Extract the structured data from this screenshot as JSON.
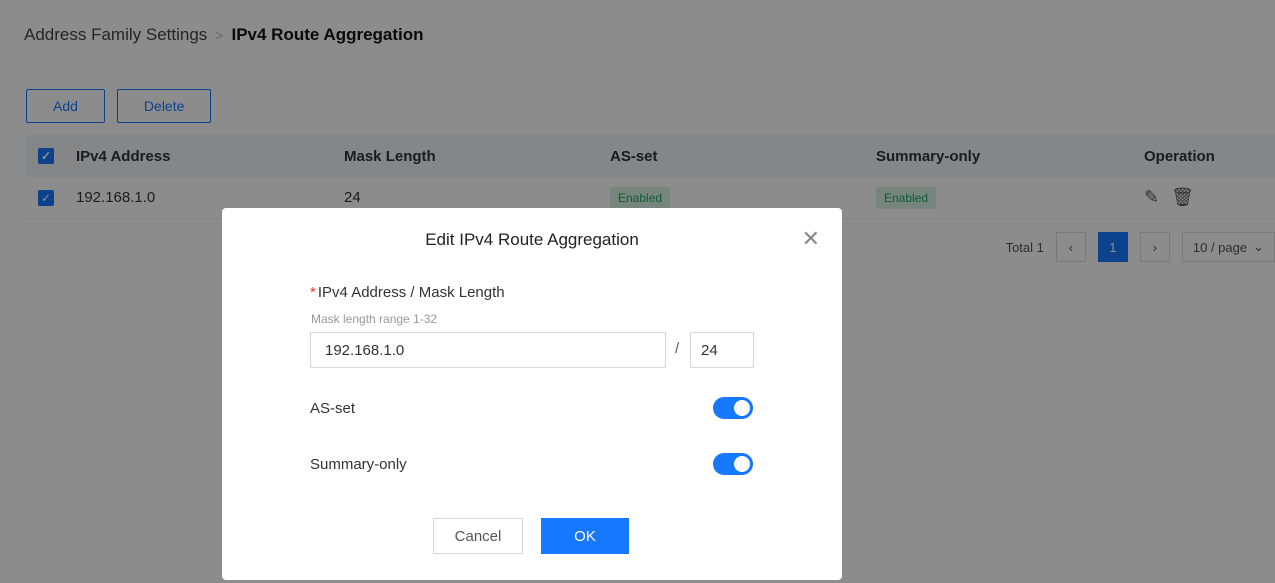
{
  "breadcrumb": {
    "parent": "Address Family Settings",
    "separator": ">",
    "current": "IPv4 Route Aggregation"
  },
  "toolbar": {
    "add_label": "Add",
    "delete_label": "Delete"
  },
  "table": {
    "headers": [
      "IPv4 Address",
      "Mask Length",
      "AS-set",
      "Summary-only",
      "Operation"
    ],
    "rows": [
      {
        "ip": "192.168.1.0",
        "mask": "24",
        "as_set": "Enabled",
        "summary_only": "Enabled",
        "checked": true
      }
    ],
    "header_checked": true
  },
  "pagination": {
    "total": "Total 1",
    "current_page": "1",
    "page_size": "10 / page"
  },
  "modal": {
    "title": "Edit IPv4 Route Aggregation",
    "field_label": "IPv4 Address / Mask Length",
    "required_mark": "*",
    "hint": "Mask length range 1-32",
    "ip_value": "192.168.1.0",
    "slash": "/",
    "mask_value": "24",
    "as_set_label": "AS-set",
    "as_set_on": true,
    "summary_only_label": "Summary-only",
    "summary_only_on": true,
    "cancel_label": "Cancel",
    "ok_label": "OK"
  },
  "icons": {
    "check": "check-icon",
    "edit": "edit-icon",
    "delete": "trash-icon",
    "close": "close-icon",
    "prev": "chevron-left-icon",
    "next": "chevron-right-icon",
    "dropdown": "chevron-down-icon"
  },
  "colors": {
    "primary": "#1677ff",
    "tag_bg": "#d8f3e6",
    "tag_text": "#1fa463",
    "required": "#e53935"
  }
}
